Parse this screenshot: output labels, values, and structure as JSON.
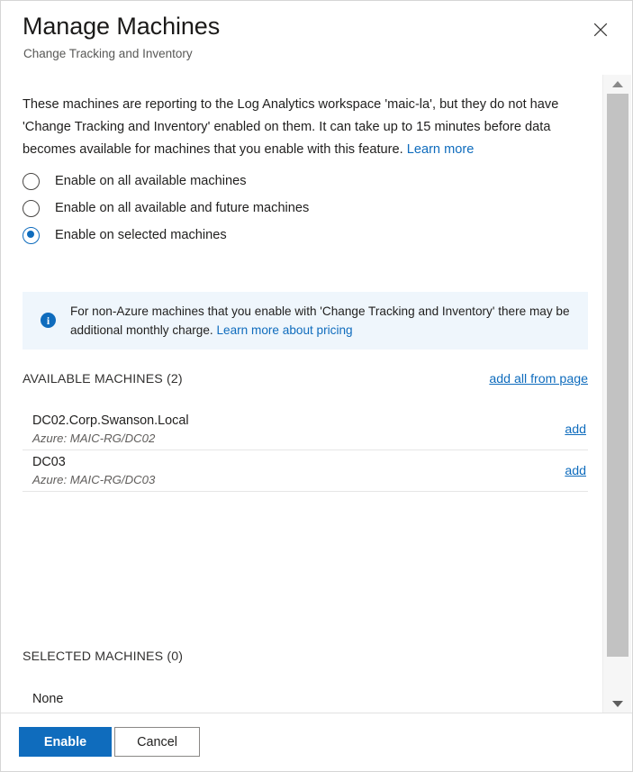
{
  "dialog": {
    "title": "Manage Machines",
    "subtitle": "Change Tracking and Inventory",
    "close_icon": "close-icon"
  },
  "intro": {
    "text": "These machines are reporting to the Log Analytics workspace 'maic-la', but they do not have 'Change Tracking and Inventory' enabled on them. It can take up to 15 minutes before data becomes available for machines that you enable with this feature. ",
    "link_label": "Learn more"
  },
  "scope_options": [
    {
      "label": "Enable on all available machines",
      "selected": false
    },
    {
      "label": "Enable on all available and future machines",
      "selected": false
    },
    {
      "label": "Enable on selected machines",
      "selected": true
    }
  ],
  "info_banner": {
    "icon": "info-icon",
    "text": "For non-Azure machines that you enable with 'Change Tracking and Inventory' there may be additional monthly charge. ",
    "link_label": "Learn more about pricing",
    "background_color": "#eff6fc",
    "icon_color": "#0f6cbd"
  },
  "available_section": {
    "title": "AVAILABLE MACHINES (2)",
    "action_label": "add all from page",
    "rows": [
      {
        "name": "DC02.Corp.Swanson.Local",
        "detail": "Azure: MAIC-RG/DC02",
        "action_label": "add"
      },
      {
        "name": "DC03",
        "detail": "Azure: MAIC-RG/DC03",
        "action_label": "add"
      }
    ]
  },
  "selected_section": {
    "title": "SELECTED MACHINES (0)",
    "empty_label": "None"
  },
  "scrollbar": {
    "up_icon": "chevron-up-icon",
    "down_icon": "chevron-down-icon"
  },
  "footer": {
    "primary_label": "Enable",
    "secondary_label": "Cancel",
    "primary_color": "#0f6cbd"
  },
  "link_color": "#0f6cbd"
}
